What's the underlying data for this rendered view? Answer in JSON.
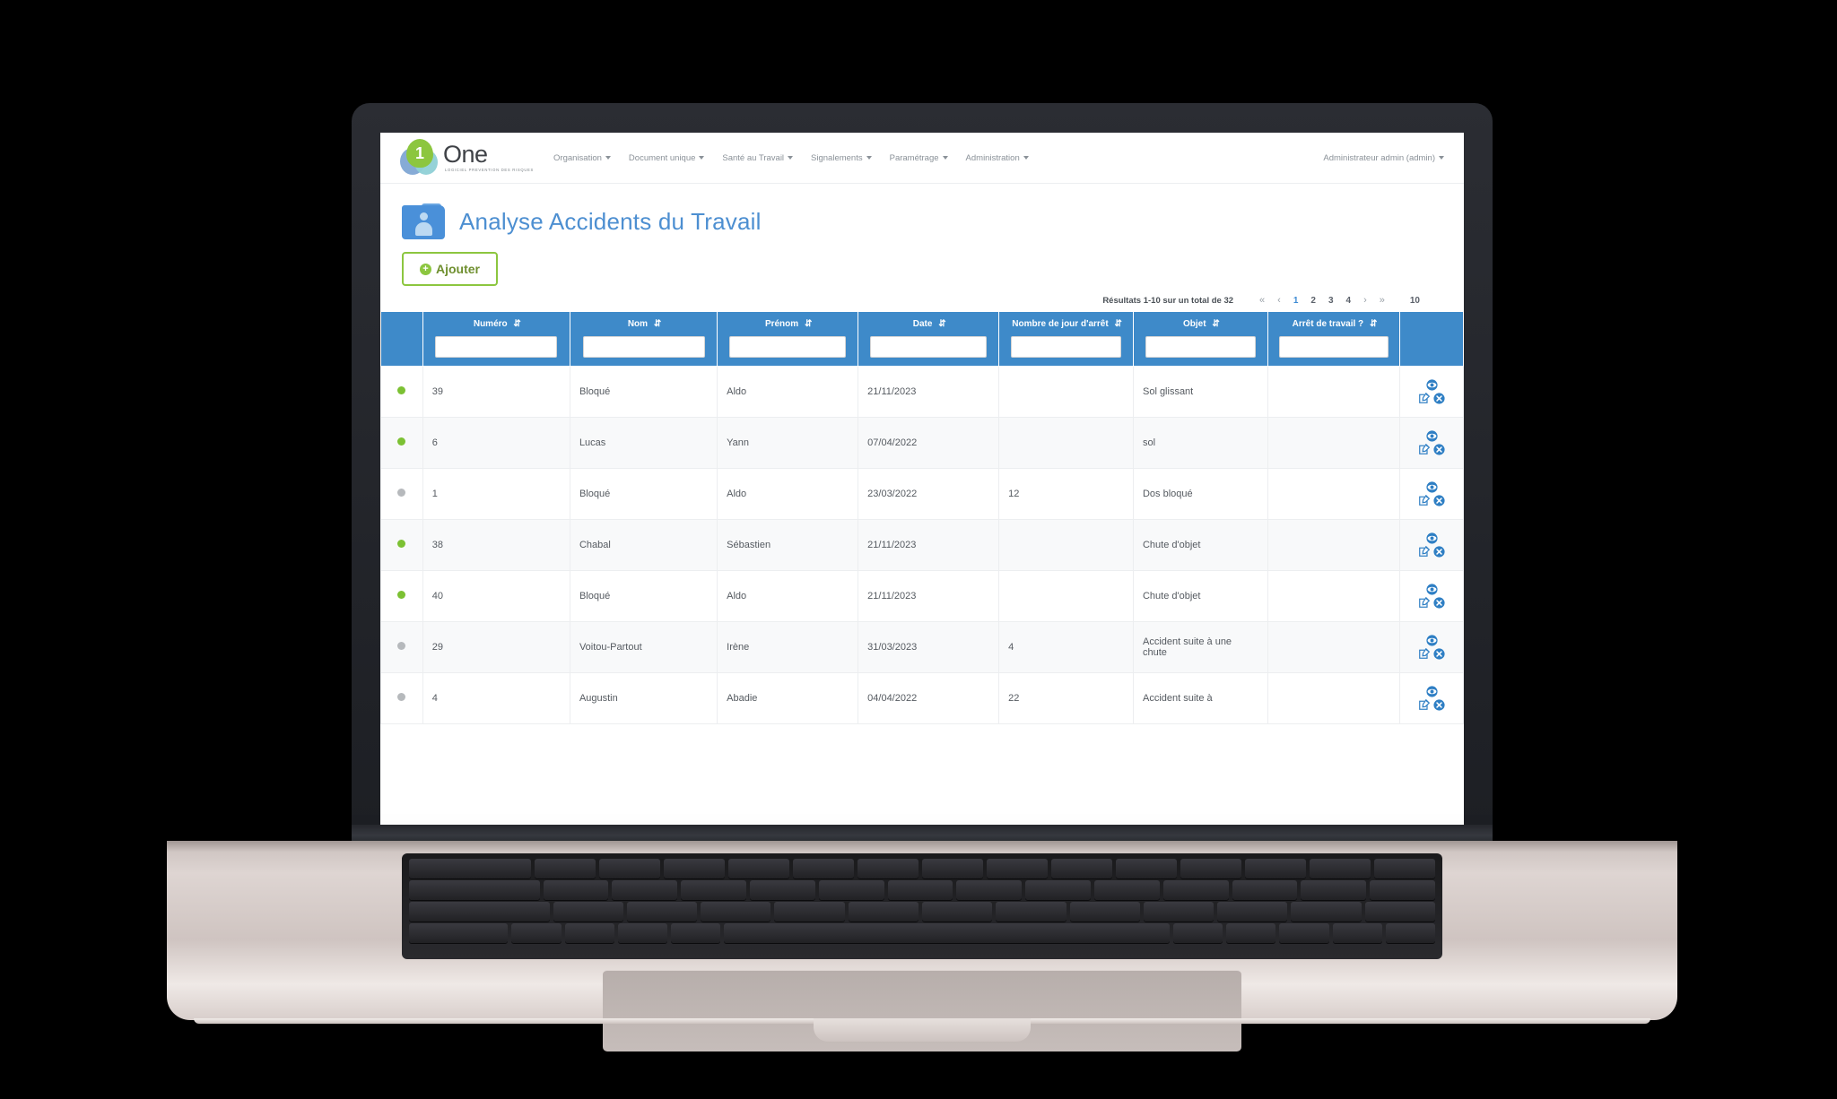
{
  "brand": {
    "logo_digit": "1",
    "logo_word": "One",
    "logo_tagline": "LOGICIEL PREVENTION DES RISQUES"
  },
  "nav": {
    "items": [
      {
        "label": "Organisation",
        "icon": "chevron-down-icon"
      },
      {
        "label": "Document unique",
        "icon": "chevron-down-icon"
      },
      {
        "label": "Santé au Travail",
        "icon": "chevron-down-icon"
      },
      {
        "label": "Signalements",
        "icon": "chevron-down-icon"
      },
      {
        "label": "Paramétrage",
        "icon": "chevron-down-icon"
      },
      {
        "label": "Administration",
        "icon": "chevron-down-icon"
      }
    ],
    "user": "Administrateur admin (admin)"
  },
  "page": {
    "title": "Analyse Accidents du Travail",
    "icon": "folder-person-icon"
  },
  "toolbar": {
    "add_label": "Ajouter",
    "add_icon": "plus-circle-icon"
  },
  "pagination": {
    "results_text": "Résultats 1-10 sur un total de 32",
    "first": "«",
    "prev": "‹",
    "pages": [
      "1",
      "2",
      "3",
      "4"
    ],
    "active_page": "1",
    "next": "›",
    "last": "»",
    "page_size": "10"
  },
  "table": {
    "sort_icon": "sort-updown-icon",
    "columns": [
      {
        "key": "status",
        "label": "",
        "filter": false
      },
      {
        "key": "numero",
        "label": "Numéro",
        "filter": true,
        "filter_value": ""
      },
      {
        "key": "nom",
        "label": "Nom",
        "filter": true,
        "filter_value": ""
      },
      {
        "key": "prenom",
        "label": "Prénom",
        "filter": true,
        "filter_value": ""
      },
      {
        "key": "date",
        "label": "Date",
        "filter": true,
        "filter_value": ""
      },
      {
        "key": "jours",
        "label": "Nombre de jour d'arrêt",
        "filter": true,
        "filter_value": ""
      },
      {
        "key": "objet",
        "label": "Objet",
        "filter": true,
        "filter_value": ""
      },
      {
        "key": "arret",
        "label": "Arrêt de travail ?",
        "filter": true,
        "filter_value": ""
      },
      {
        "key": "actions",
        "label": "",
        "filter": false
      }
    ],
    "row_actions": [
      {
        "name": "view-icon",
        "label": "Voir"
      },
      {
        "name": "edit-icon",
        "label": "Modifier"
      },
      {
        "name": "delete-icon",
        "label": "Supprimer"
      }
    ],
    "rows": [
      {
        "status": "green",
        "numero": "39",
        "nom": "Bloqué",
        "prenom": "Aldo",
        "date": "21/11/2023",
        "jours": "",
        "objet": "Sol glissant",
        "arret": ""
      },
      {
        "status": "green",
        "numero": "6",
        "nom": "Lucas",
        "prenom": "Yann",
        "date": "07/04/2022",
        "jours": "",
        "objet": "sol",
        "arret": ""
      },
      {
        "status": "grey",
        "numero": "1",
        "nom": "Bloqué",
        "prenom": "Aldo",
        "date": "23/03/2022",
        "jours": "12",
        "objet": "Dos bloqué",
        "arret": ""
      },
      {
        "status": "green",
        "numero": "38",
        "nom": "Chabal",
        "prenom": "Sébastien",
        "date": "21/11/2023",
        "jours": "",
        "objet": "Chute d'objet",
        "arret": ""
      },
      {
        "status": "green",
        "numero": "40",
        "nom": "Bloqué",
        "prenom": "Aldo",
        "date": "21/11/2023",
        "jours": "",
        "objet": "Chute d'objet",
        "arret": ""
      },
      {
        "status": "grey",
        "numero": "29",
        "nom": "Voitou-Partout",
        "prenom": "Irène",
        "date": "31/03/2023",
        "jours": "4",
        "objet": "Accident suite à une chute",
        "arret": ""
      },
      {
        "status": "grey",
        "numero": "4",
        "nom": "Augustin",
        "prenom": "Abadie",
        "date": "04/04/2022",
        "jours": "22",
        "objet": "Accident suite à",
        "arret": ""
      }
    ]
  },
  "colors": {
    "header_blue": "#3e8ac9",
    "title_blue": "#4d8fd1",
    "accent_green": "#8cc63f",
    "status_green": "#7cc133",
    "status_grey": "#b6b9bc"
  }
}
